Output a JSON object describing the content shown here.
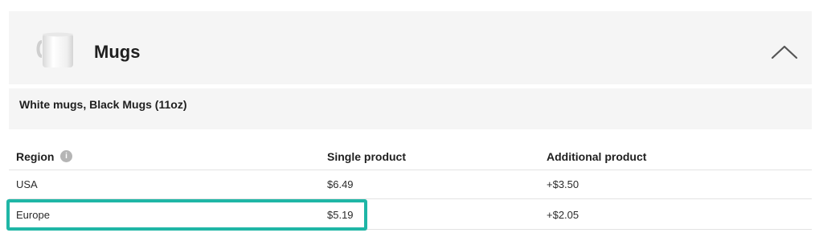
{
  "product": {
    "title": "Mugs",
    "icon": "mug-icon",
    "collapse_icon": "chevron-up-icon",
    "subtitle": "White mugs, Black Mugs (11oz)"
  },
  "table": {
    "headers": {
      "region": "Region",
      "region_info": "i",
      "single": "Single product",
      "additional": "Additional product"
    },
    "rows": [
      {
        "region": "USA",
        "single": "$6.49",
        "additional": "+$3.50"
      },
      {
        "region": "Europe",
        "single": "$5.19",
        "additional": "+$2.05"
      }
    ],
    "highlighted_row": "Europe"
  },
  "colors": {
    "panel_bg": "#f5f5f5",
    "highlight": "#1fb6a6",
    "divider": "#e3e3e3"
  }
}
